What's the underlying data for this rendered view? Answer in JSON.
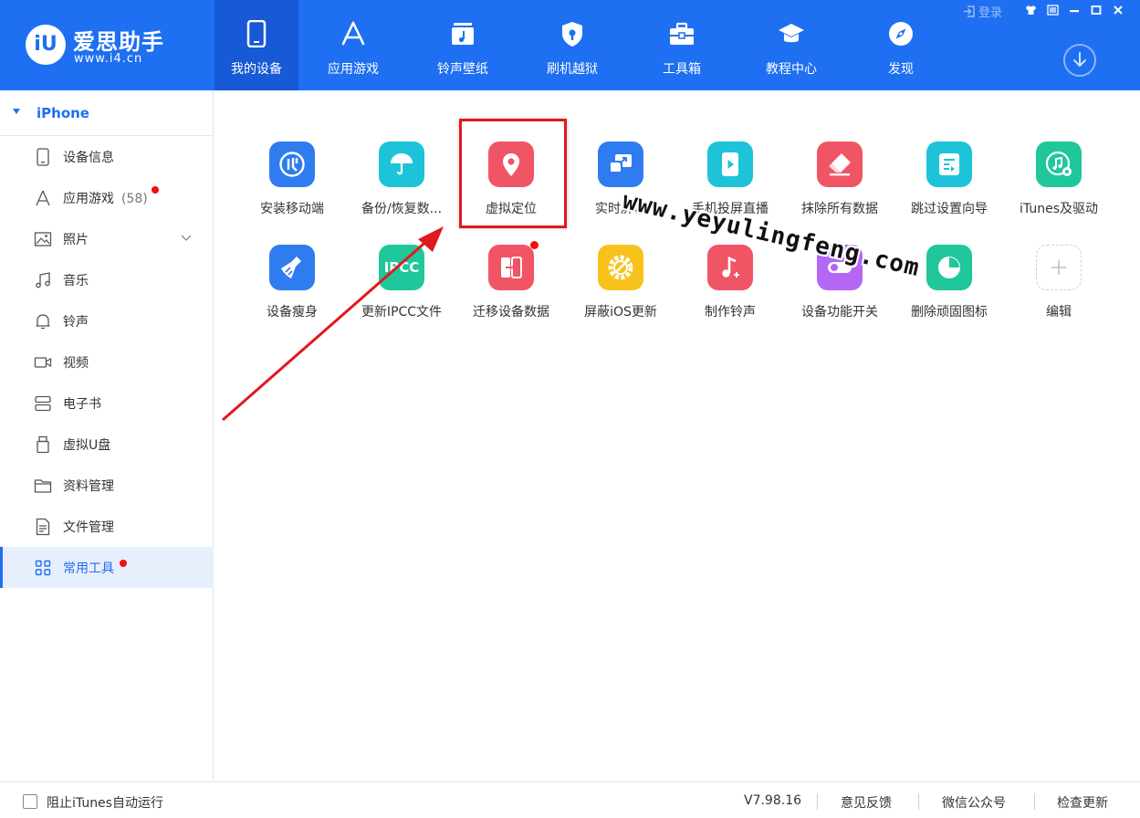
{
  "app": {
    "logo_mark": "iU",
    "logo_name": "爱思助手",
    "logo_url": "www.i4.cn"
  },
  "nav": [
    {
      "label": "我的设备",
      "icon": "phone-icon",
      "active": true
    },
    {
      "label": "应用游戏",
      "icon": "app-store-icon"
    },
    {
      "label": "铃声壁纸",
      "icon": "music-folder-icon"
    },
    {
      "label": "刷机越狱",
      "icon": "shield-icon"
    },
    {
      "label": "工具箱",
      "icon": "toolbox-icon"
    },
    {
      "label": "教程中心",
      "icon": "graduation-cap-icon"
    },
    {
      "label": "发现",
      "icon": "compass-icon"
    }
  ],
  "window": {
    "login_label": "登录"
  },
  "sidebar": {
    "device_name": "iPhone",
    "items": [
      {
        "label": "设备信息",
        "icon": "device-info-icon"
      },
      {
        "label": "应用游戏",
        "icon": "apps-icon",
        "count": "(58)",
        "dot": true
      },
      {
        "label": "照片",
        "icon": "photo-icon",
        "expandable": true
      },
      {
        "label": "音乐",
        "icon": "music-icon"
      },
      {
        "label": "铃声",
        "icon": "bell-icon"
      },
      {
        "label": "视频",
        "icon": "video-icon"
      },
      {
        "label": "电子书",
        "icon": "ebook-icon"
      },
      {
        "label": "虚拟U盘",
        "icon": "usb-drive-icon"
      },
      {
        "label": "资料管理",
        "icon": "folder-icon"
      },
      {
        "label": "文件管理",
        "icon": "file-icon"
      },
      {
        "label": "常用工具",
        "icon": "grid-icon",
        "active": true,
        "dot": true
      }
    ]
  },
  "tools": [
    {
      "label": "安装移动端",
      "icon": "i4-app-icon",
      "color": "#2f7cf0"
    },
    {
      "label": "备份/恢复数...",
      "icon": "umbrella-icon",
      "color": "#1cc3d9"
    },
    {
      "label": "虚拟定位",
      "icon": "location-pin-icon",
      "color": "#f05565"
    },
    {
      "label": "实时屏幕",
      "icon": "screen-mirror-icon",
      "color": "#2f7cf0"
    },
    {
      "label": "手机投屏直播",
      "icon": "screen-cast-icon",
      "color": "#1cc3d9"
    },
    {
      "label": "抹除所有数据",
      "icon": "eraser-icon",
      "color": "#f05565"
    },
    {
      "label": "跳过设置向导",
      "icon": "skip-setup-icon",
      "color": "#1cc3d9"
    },
    {
      "label": "iTunes及驱动",
      "icon": "itunes-icon",
      "color": "#1fc79b"
    },
    {
      "label": "设备瘦身",
      "icon": "broom-icon",
      "color": "#2f7cf0"
    },
    {
      "label": "更新IPCC文件",
      "icon": "ipcc-icon",
      "color": "#1fc79b",
      "tile_text": "IPCC"
    },
    {
      "label": "迁移设备数据",
      "icon": "migrate-icon",
      "color": "#f05565",
      "dot": true
    },
    {
      "label": "屏蔽iOS更新",
      "icon": "block-update-icon",
      "color": "#f7c21c"
    },
    {
      "label": "制作铃声",
      "icon": "make-ringtone-icon",
      "color": "#f05565"
    },
    {
      "label": "设备功能开关",
      "icon": "toggle-icon",
      "color": "#b467f5"
    },
    {
      "label": "删除顽固图标",
      "icon": "delete-icon-icon",
      "color": "#1fc79b"
    },
    {
      "label": "编辑",
      "icon": "plus-icon",
      "color": "#ffffff"
    }
  ],
  "watermark": "www.yeyulingfeng.com",
  "footer": {
    "itunes_label": "阻止iTunes自动运行",
    "version": "V7.98.16",
    "feedback": "意见反馈",
    "wechat": "微信公众号",
    "update": "检查更新"
  }
}
